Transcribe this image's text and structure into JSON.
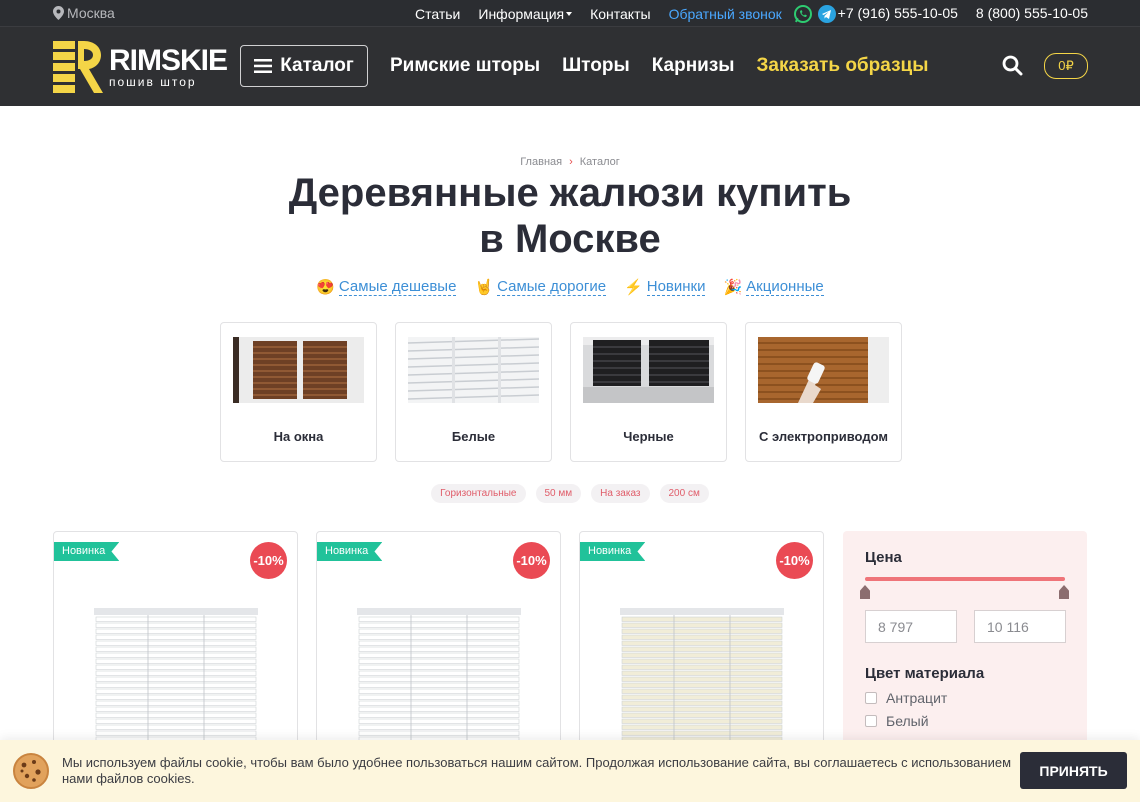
{
  "topbar": {
    "city": "Москва",
    "nav": [
      "Статьи",
      "Информация",
      "Контакты"
    ],
    "callback": "Обратный звонок",
    "phones": [
      "+7 (916) 555-10-05",
      "8 (800) 555-10-05"
    ],
    "icons": [
      "location-pin-icon",
      "whatsapp-icon",
      "telegram-icon",
      "chevron-down-icon"
    ]
  },
  "header": {
    "logo_name": "RIMSKIE",
    "logo_tagline": "пошив штор",
    "catalog_label": "Каталог",
    "nav": [
      "Римские шторы",
      "Шторы",
      "Карнизы"
    ],
    "highlight_nav": "Заказать образцы",
    "cart_value": "0₽",
    "accent_color": "#f4d547"
  },
  "breadcrumbs": [
    "Главная",
    "Каталог"
  ],
  "page_title_line1": "Деревянные жалюзи купить",
  "page_title_line2": "в Москве",
  "quick_filters": [
    {
      "emoji": "😍",
      "label": "Самые дешевые"
    },
    {
      "emoji": "🤘",
      "label": "Самые дорогие"
    },
    {
      "emoji": "⚡",
      "label": "Новинки"
    },
    {
      "emoji": "🎉",
      "label": "Акционные"
    }
  ],
  "categories": [
    {
      "label": "На окна"
    },
    {
      "label": "Белые"
    },
    {
      "label": "Черные"
    },
    {
      "label": "С электроприводом"
    }
  ],
  "tags": [
    "Горизонтальные",
    "50 мм",
    "На заказ",
    "200 см"
  ],
  "products": [
    {
      "badge": "Новинка",
      "discount": "-10%",
      "color": "#ffffff"
    },
    {
      "badge": "Новинка",
      "discount": "-10%",
      "color": "#ffffff"
    },
    {
      "badge": "Новинка",
      "discount": "-10%",
      "color": "#f1edd8"
    }
  ],
  "sidebar": {
    "price_heading": "Цена",
    "price_min": "8 797",
    "price_max": "10 116",
    "color_heading": "Цвет материала",
    "colors": [
      "Антрацит",
      "Белый"
    ]
  },
  "cookie": {
    "text": "Мы используем файлы cookie, чтобы вам было удобнее пользоваться нашим сайтом. Продолжая использование сайта, вы соглашаетесь с использованием нами файлов cookies.",
    "accept_label": "ПРИНЯТЬ"
  }
}
